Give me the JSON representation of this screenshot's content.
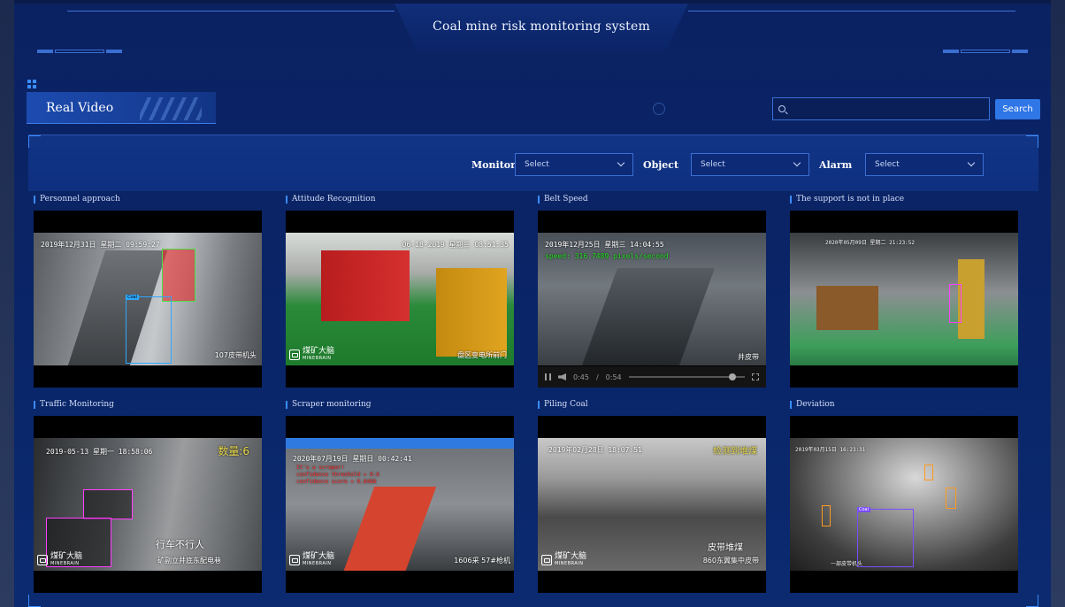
{
  "header": {
    "title": "Coal mine risk monitoring system"
  },
  "tab": {
    "label": "Real Video"
  },
  "search": {
    "placeholder": "",
    "button_label": "Search"
  },
  "filters": [
    {
      "label": "Monitor",
      "value": "Select"
    },
    {
      "label": "Object",
      "value": "Select"
    },
    {
      "label": "Alarm",
      "value": "Select"
    }
  ],
  "videos": [
    {
      "caption": "Personnel approach",
      "timestamp": "2019年12月31日 星期二 09:59:27",
      "location": "107皮带机头",
      "tags": [
        "Coal"
      ]
    },
    {
      "caption": "Attitude Recognition",
      "timestamp": "06-18-2019 星期三 08:51:35",
      "location": "盘区变电所前门",
      "brand_cn": "煤矿大脑",
      "brand_en": "MINEBRAIN"
    },
    {
      "caption": "Belt Speed",
      "timestamp": "2019年12月25日 星期三 14:04:55",
      "overlay": "speed: 316.7489 pixels/second",
      "location": "井皮带",
      "player": {
        "current": "0:45",
        "separator": "/",
        "duration": "0:54",
        "progress": 0.83
      }
    },
    {
      "caption": "The support is not in place",
      "timestamp": "2020年05月09日 星期二 21:23:52"
    },
    {
      "caption": "Traffic Monitoring",
      "timestamp": "2019-05-13 星期一 18:58:06",
      "count": "数量:6",
      "overlay_cn": "行车不行人",
      "location": "矿副立井底东配电巷",
      "brand_cn": "煤矿大脑",
      "brand_en": "MINEBRAIN"
    },
    {
      "caption": "Scraper monitoring",
      "timestamp": "2020年07月19日 星期日 00:42:41",
      "lines": [
        "It's a scraper!",
        "confidence threshold = 0.6",
        "confidence score = 0.8488"
      ],
      "location": "1606采 57#枪机",
      "brand_cn": "煤矿大脑",
      "brand_en": "MINEBRAIN"
    },
    {
      "caption": "Piling Coal",
      "timestamp": "2019年02月28日 18:07:51",
      "alert": "检测到堆煤",
      "overlay_cn": "皮带堆煤",
      "location": "860东翼集中皮带",
      "brand_cn": "煤矿大脑",
      "brand_en": "MINEBRAIN"
    },
    {
      "caption": "Deviation",
      "timestamp": "2019年03月15日 16:23:31",
      "location": "一部皮带机头",
      "tags": [
        "Coal"
      ]
    }
  ],
  "colors": {
    "accent": "#2f76e6",
    "background": "#0a2466",
    "panel": "#173f98"
  }
}
